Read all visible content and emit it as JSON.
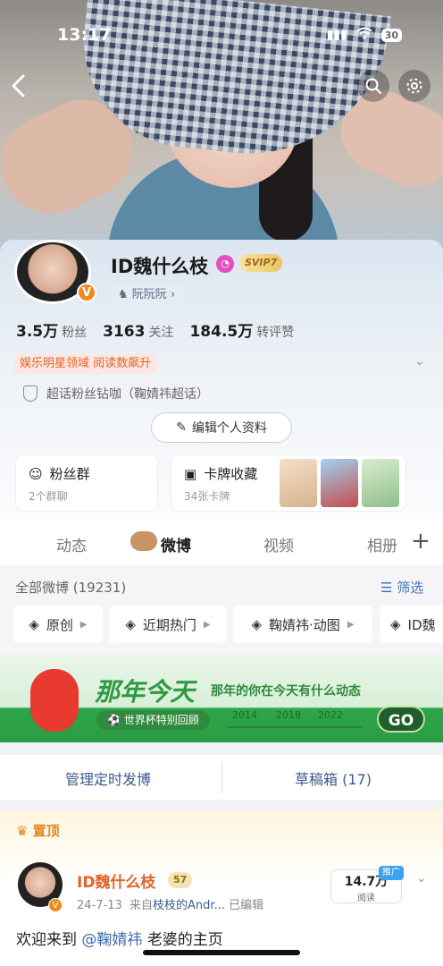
{
  "status_bar": {
    "time": "13:17",
    "battery": "30"
  },
  "profile": {
    "username": "ID魏什么枝",
    "vip_label": "SVIP7",
    "group_chip": "阮阮阮",
    "stats": [
      {
        "value": "3.5万",
        "label": "粉丝"
      },
      {
        "value": "3163",
        "label": "关注"
      },
      {
        "value": "184.5万",
        "label": "转评赞"
      }
    ],
    "honor": "娱乐明星领域 阅读数飙升",
    "super_topic": "超话粉丝钻咖（鞠婧祎超话）",
    "edit_button": "编辑个人资料",
    "fan_group": {
      "title": "粉丝群",
      "sub": "2个群聊"
    },
    "card_collection": {
      "title": "卡牌收藏",
      "sub": "34张卡牌"
    }
  },
  "tabs": [
    {
      "label": "动态"
    },
    {
      "label": "微博"
    },
    {
      "label": "视频"
    },
    {
      "label": "相册"
    }
  ],
  "feed": {
    "all_posts": "全部微博 (19231)",
    "filter": "筛选",
    "chips": [
      "原创",
      "近期热门",
      "鞠婧祎·动图",
      "ID魏"
    ]
  },
  "banner": {
    "title": "那年今天",
    "subtitle": "那年的你在今天有什么动态",
    "tag": "世界杯特别回顾",
    "years": [
      "2014",
      "2018",
      "2022"
    ],
    "go": "GO"
  },
  "manage": {
    "scheduled": "管理定时发博",
    "drafts": "草稿箱 (17)"
  },
  "post": {
    "pinned": "置顶",
    "username": "ID魏什么枝",
    "level": "57",
    "date": "24-7-13",
    "source_prefix": "来自",
    "source": "枝枝的Andr...",
    "edited": "已编辑",
    "reads_value": "14.7万",
    "reads_label": "阅读",
    "promo": "推广",
    "text_before": "欢迎来到",
    "mention": "@鞠婧祎",
    "text_after": "老婆的主页"
  },
  "colors": {
    "accent_orange": "#e2642a",
    "link_blue": "#3f75b8",
    "banner_green": "#2f9a42"
  }
}
